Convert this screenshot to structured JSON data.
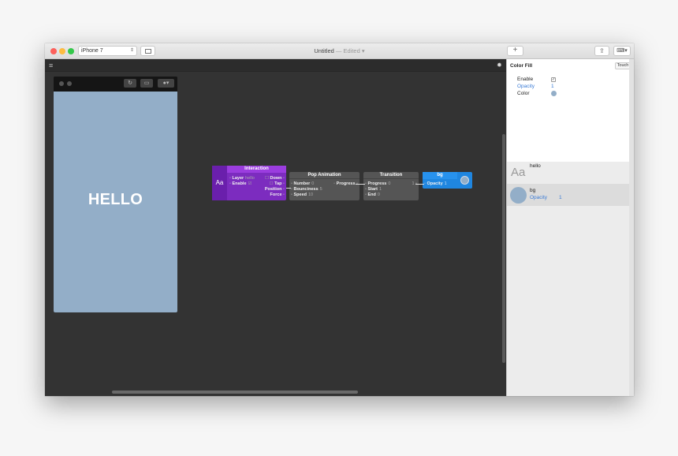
{
  "titlebar": {
    "device": "iPhone 7",
    "title": "Untitled",
    "status": "— Edited ▾",
    "add_label": "+"
  },
  "canvas": {
    "menu_icon": "hamburger-icon",
    "settings_icon": "gear-icon"
  },
  "preview": {
    "hello_text": "HELLO",
    "screen_color": "#93aec8"
  },
  "nodes": {
    "interaction": {
      "title": "Interaction",
      "icon": "Aa",
      "inputs": [
        {
          "label": "Layer",
          "value": "hello"
        },
        {
          "label": "Enable",
          "value": "☑"
        }
      ],
      "outputs": [
        "Down",
        "Tap",
        "Position",
        "Force"
      ]
    },
    "pop_animation": {
      "title": "Pop Animation",
      "inputs": [
        {
          "label": "Number",
          "value": "0"
        },
        {
          "label": "Bounciness",
          "value": "5"
        },
        {
          "label": "Speed",
          "value": "10"
        }
      ],
      "output": "Progress"
    },
    "transition": {
      "title": "Transition",
      "inputs": [
        {
          "label": "Progress",
          "value": "0"
        },
        {
          "label": "Start",
          "value": "1"
        },
        {
          "label": "End",
          "value": "0"
        }
      ]
    },
    "bg": {
      "title": "bg",
      "inputs": [
        {
          "label": "Opacity",
          "value": "1"
        }
      ],
      "color": "#93aec8"
    }
  },
  "inspector": {
    "title": "Color Fill",
    "touch_label": "Touch",
    "props": [
      {
        "label": "Enable",
        "value": "✓"
      },
      {
        "label": "Opacity",
        "value": "1"
      },
      {
        "label": "Color",
        "value": ""
      }
    ],
    "layers": [
      {
        "icon": "Aa",
        "name": "hello"
      },
      {
        "name": "bg",
        "prop": "Opacity",
        "value": "1"
      }
    ]
  }
}
